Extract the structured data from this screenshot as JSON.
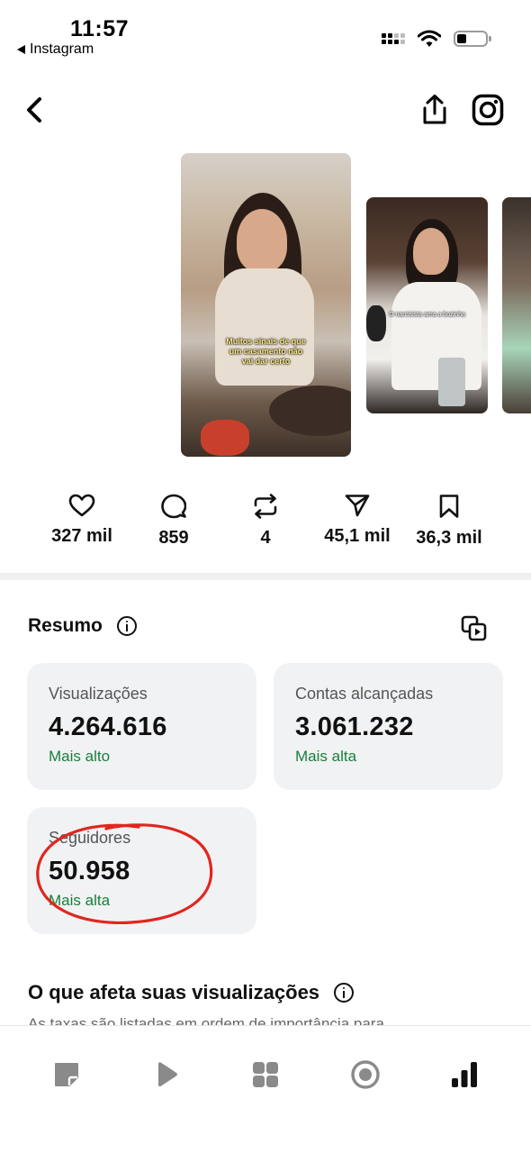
{
  "status_bar": {
    "time": "11:57",
    "back_app": "Instagram"
  },
  "header": {
    "back_icon": "chevron-left-icon",
    "share_icon": "share-icon",
    "instagram_icon": "instagram-icon"
  },
  "reels": {
    "main_caption": "Muitos sinais de que um casamento não vai dar certo",
    "second_caption": "O narcisista ama a bozinha"
  },
  "engagement": {
    "likes": "327 mil",
    "comments": "859",
    "reposts": "4",
    "shares": "45,1 mil",
    "saves": "36,3 mil"
  },
  "summary": {
    "title": "Resumo",
    "cards": [
      {
        "label": "Visualizações",
        "value": "4.264.616",
        "trend": "Mais alto"
      },
      {
        "label": "Contas alcançadas",
        "value": "3.061.232",
        "trend": "Mais alta"
      },
      {
        "label": "Seguidores",
        "value": "50.958",
        "trend": "Mais alta"
      }
    ]
  },
  "views_section": {
    "title": "O que afeta suas visualizações",
    "subtitle": "As taxas são listadas em ordem de importância para"
  },
  "colors": {
    "trend_green": "#18803a",
    "annotation_red": "#e0261e",
    "card_bg": "#f1f2f4"
  }
}
